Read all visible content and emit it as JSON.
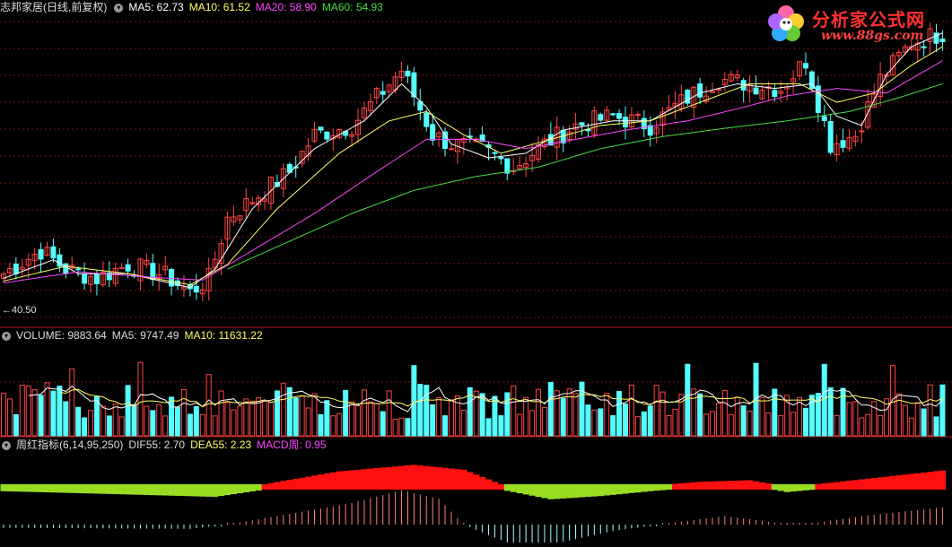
{
  "header_main": {
    "name": "志邦家居",
    "period": "(日线,前复权)",
    "ma5": "MA5: 62.73",
    "ma10": "MA10: 61.52",
    "ma20": "MA20: 58.90",
    "ma60": "MA60: 54.93",
    "icon": "chevron-down-icon"
  },
  "low_label": "40.50",
  "header_volume": {
    "volume": "VOLUME: 9883.64",
    "ma5": "MA5: 9747.49",
    "ma10": "MA10: 11631.22",
    "icon": "chevron-down-icon"
  },
  "header_indicator": {
    "name": "周红指标",
    "params": "(6,14,95,250)",
    "dif": "DIF55: 2.70",
    "dea": "DEA55: 2.23",
    "macd": "MACD周: 0.95",
    "icon": "chevron-down-icon"
  },
  "logo": {
    "title": "分析家公式网",
    "url": "www.88gs.com"
  },
  "colors": {
    "ma5": "#ffffff",
    "ma10": "#ffff66",
    "ma20": "#ff44ff",
    "ma60": "#44dd44",
    "up": "#ff4444",
    "down": "#55ffff",
    "grid": "#7a1010",
    "macd_pos": "#ff1010",
    "macd_neg": "#99dd22"
  },
  "chart_data": [
    {
      "type": "candlestick",
      "panel": "price",
      "count": 152,
      "ylim": [
        38.5,
        72
      ],
      "low_marker": 40.5,
      "close_anchors": [
        [
          0,
          44
        ],
        [
          6,
          46.5
        ],
        [
          10,
          44.5
        ],
        [
          15,
          43.5
        ],
        [
          20,
          45
        ],
        [
          26,
          43.8
        ],
        [
          30,
          42
        ],
        [
          33,
          43.5
        ],
        [
          36,
          50
        ],
        [
          40,
          52
        ],
        [
          46,
          55
        ],
        [
          50,
          59
        ],
        [
          56,
          60
        ],
        [
          60,
          63
        ],
        [
          64,
          66
        ],
        [
          69,
          59
        ],
        [
          72,
          58
        ],
        [
          77,
          57.5
        ],
        [
          82,
          55.5
        ],
        [
          87,
          58
        ],
        [
          92,
          60
        ],
        [
          98,
          61
        ],
        [
          104,
          60
        ],
        [
          110,
          63
        ],
        [
          115,
          65
        ],
        [
          120,
          64.5
        ],
        [
          125,
          64
        ],
        [
          129,
          67
        ],
        [
          133,
          58
        ],
        [
          137,
          59
        ],
        [
          141,
          65
        ],
        [
          146,
          69
        ],
        [
          151,
          70
        ]
      ],
      "ma_series": [
        {
          "name": "MA5",
          "anchors": [
            [
              0,
              43.5
            ],
            [
              8,
              45.5
            ],
            [
              12,
              44
            ],
            [
              20,
              44
            ],
            [
              30,
              42.5
            ],
            [
              34,
              44.5
            ],
            [
              40,
              51
            ],
            [
              50,
              57.5
            ],
            [
              58,
              60.5
            ],
            [
              64,
              64.5
            ],
            [
              68,
              62
            ],
            [
              72,
              58
            ],
            [
              78,
              56.5
            ],
            [
              84,
              57
            ],
            [
              90,
              59.5
            ],
            [
              98,
              60.5
            ],
            [
              104,
              60.5
            ],
            [
              112,
              63.5
            ],
            [
              118,
              64.5
            ],
            [
              124,
              64
            ],
            [
              130,
              64.5
            ],
            [
              134,
              61
            ],
            [
              138,
              60
            ],
            [
              142,
              65.5
            ],
            [
              146,
              68.5
            ],
            [
              151,
              70
            ]
          ]
        },
        {
          "name": "MA10",
          "anchors": [
            [
              0,
              43.2
            ],
            [
              10,
              44.8
            ],
            [
              20,
              44
            ],
            [
              30,
              42.8
            ],
            [
              36,
              45
            ],
            [
              44,
              51
            ],
            [
              54,
              57
            ],
            [
              62,
              60.5
            ],
            [
              68,
              61.5
            ],
            [
              74,
              59
            ],
            [
              80,
              57
            ],
            [
              88,
              58.5
            ],
            [
              96,
              60
            ],
            [
              104,
              60.5
            ],
            [
              112,
              62.5
            ],
            [
              120,
              64.5
            ],
            [
              128,
              64.5
            ],
            [
              134,
              62.5
            ],
            [
              140,
              63.5
            ],
            [
              146,
              66.5
            ],
            [
              151,
              68.5
            ]
          ]
        },
        {
          "name": "MA20",
          "anchors": [
            [
              0,
              43
            ],
            [
              12,
              44.2
            ],
            [
              24,
              43.6
            ],
            [
              32,
              43.3
            ],
            [
              40,
              46.5
            ],
            [
              50,
              50.5
            ],
            [
              60,
              55
            ],
            [
              68,
              58.5
            ],
            [
              76,
              58.5
            ],
            [
              84,
              57.5
            ],
            [
              92,
              58.5
            ],
            [
              100,
              59.5
            ],
            [
              110,
              60.5
            ],
            [
              118,
              61.8
            ],
            [
              126,
              63.2
            ],
            [
              134,
              64
            ],
            [
              142,
              63.5
            ],
            [
              151,
              67
            ]
          ]
        },
        {
          "name": "MA60",
          "anchors": [
            [
              36,
              44.5
            ],
            [
              46,
              47.5
            ],
            [
              56,
              50.5
            ],
            [
              66,
              53
            ],
            [
              76,
              54.5
            ],
            [
              86,
              55.5
            ],
            [
              96,
              57.5
            ],
            [
              106,
              58.8
            ],
            [
              116,
              59.7
            ],
            [
              126,
              60.5
            ],
            [
              136,
              61.5
            ],
            [
              144,
              63
            ],
            [
              151,
              64.5
            ]
          ]
        }
      ]
    },
    {
      "type": "bar",
      "panel": "volume",
      "ylim": [
        0,
        22000
      ],
      "last_volume": 9883.64,
      "ma5_last": 9747.49,
      "ma10_last": 11631.22
    },
    {
      "type": "histogram",
      "panel": "indicator",
      "name": "周红指标",
      "dif": 2.7,
      "dea": 2.23,
      "macd": 0.95,
      "area_anchors": [
        [
          0,
          -0.2
        ],
        [
          20,
          -0.6
        ],
        [
          34,
          -0.9
        ],
        [
          42,
          0
        ],
        [
          54,
          1.6
        ],
        [
          66,
          2.4
        ],
        [
          74,
          1.8
        ],
        [
          80,
          0
        ],
        [
          88,
          -1.2
        ],
        [
          96,
          -0.8
        ],
        [
          104,
          -0.2
        ],
        [
          112,
          0.3
        ],
        [
          120,
          0.5
        ],
        [
          126,
          -0.3
        ],
        [
          132,
          0.1
        ],
        [
          138,
          0.6
        ],
        [
          151,
          1.7
        ]
      ],
      "bar_anchors": [
        [
          0,
          -0.3
        ],
        [
          30,
          -0.4
        ],
        [
          36,
          0
        ],
        [
          44,
          0.8
        ],
        [
          56,
          2.0
        ],
        [
          64,
          3.2
        ],
        [
          70,
          2.4
        ],
        [
          74,
          0
        ],
        [
          84,
          -2.4
        ],
        [
          90,
          -1.6
        ],
        [
          98,
          -0.6
        ],
        [
          108,
          0.2
        ],
        [
          116,
          0.8
        ],
        [
          124,
          0.2
        ],
        [
          130,
          0.1
        ],
        [
          138,
          0.8
        ],
        [
          151,
          1.6
        ]
      ]
    }
  ]
}
